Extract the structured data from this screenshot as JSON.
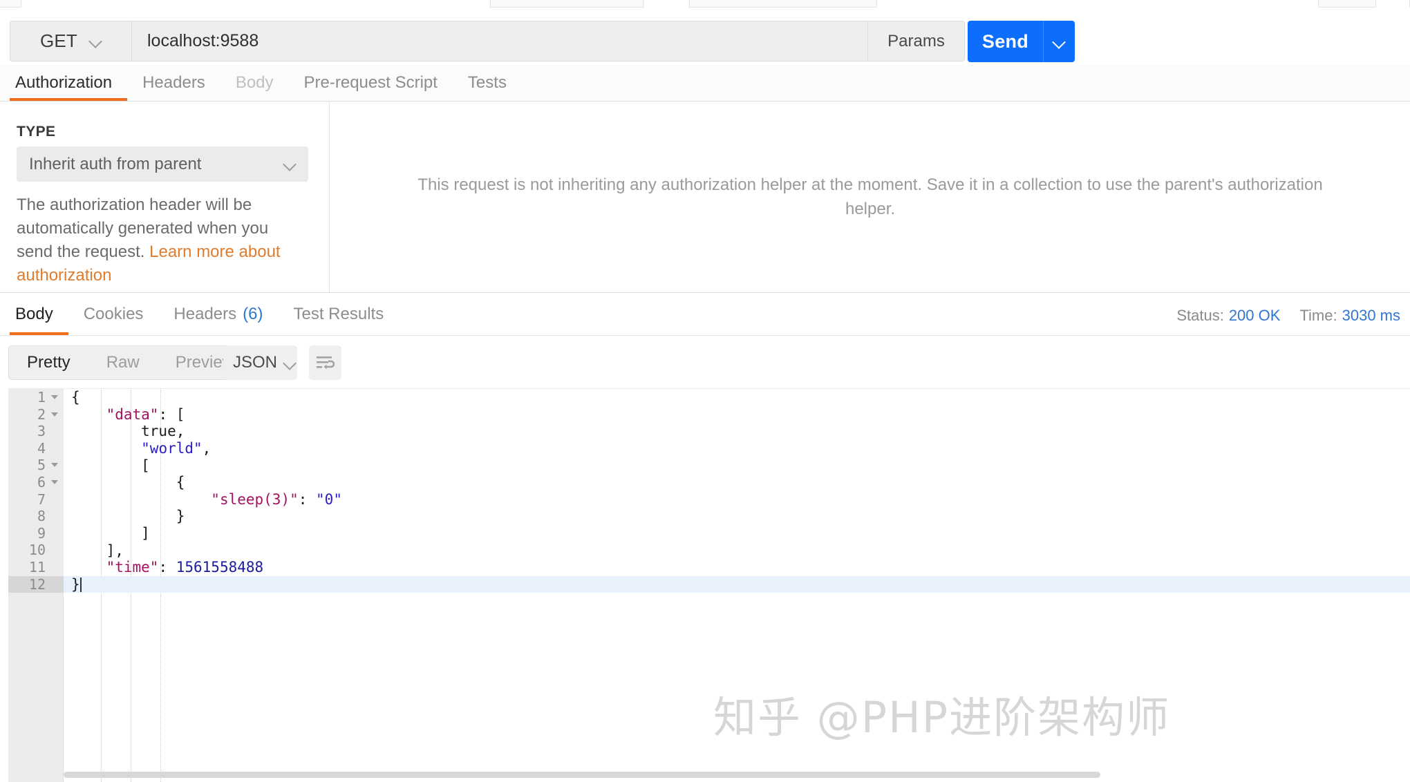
{
  "request": {
    "method": "GET",
    "url": "localhost:9588",
    "params_label": "Params",
    "send_label": "Send",
    "tabs": [
      {
        "label": "Authorization",
        "state": "active"
      },
      {
        "label": "Headers",
        "state": "normal"
      },
      {
        "label": "Body",
        "state": "dim"
      },
      {
        "label": "Pre-request Script",
        "state": "normal"
      },
      {
        "label": "Tests",
        "state": "normal"
      }
    ]
  },
  "auth": {
    "type_heading": "TYPE",
    "type_value": "Inherit auth from parent",
    "description_text": "The authorization header will be automatically generated when you send the request. ",
    "description_link": "Learn more about authorization",
    "inherit_message_line1": "This request is not inheriting any authorization helper at the moment. Save it in a collection to use the parent's authorization",
    "inherit_message_line2": "helper."
  },
  "response": {
    "tabs": [
      {
        "label": "Body",
        "count": "",
        "state": "active"
      },
      {
        "label": "Cookies",
        "count": "",
        "state": "normal"
      },
      {
        "label": "Headers",
        "count": "(6)",
        "state": "normal"
      },
      {
        "label": "Test Results",
        "count": "",
        "state": "normal"
      }
    ],
    "status_label": "Status:",
    "status_value": "200 OK",
    "time_label": "Time:",
    "time_value": "3030 ms",
    "view_modes": [
      {
        "label": "Pretty",
        "state": "active"
      },
      {
        "label": "Raw",
        "state": "normal"
      },
      {
        "label": "Preview",
        "state": "normal"
      }
    ],
    "format": "JSON",
    "wrap_icon": "word-wrap-icon",
    "body_lines": [
      {
        "num": "1",
        "fold": true,
        "segments": [
          {
            "t": "{",
            "c": ""
          }
        ]
      },
      {
        "num": "2",
        "fold": true,
        "segments": [
          {
            "t": "    ",
            "c": ""
          },
          {
            "t": "\"data\"",
            "c": "k"
          },
          {
            "t": ": [",
            "c": ""
          }
        ]
      },
      {
        "num": "3",
        "fold": false,
        "segments": [
          {
            "t": "        true,",
            "c": ""
          }
        ]
      },
      {
        "num": "4",
        "fold": false,
        "segments": [
          {
            "t": "        ",
            "c": ""
          },
          {
            "t": "\"world\"",
            "c": "s"
          },
          {
            "t": ",",
            "c": ""
          }
        ]
      },
      {
        "num": "5",
        "fold": true,
        "segments": [
          {
            "t": "        [",
            "c": ""
          }
        ]
      },
      {
        "num": "6",
        "fold": true,
        "segments": [
          {
            "t": "            {",
            "c": ""
          }
        ]
      },
      {
        "num": "7",
        "fold": false,
        "segments": [
          {
            "t": "                ",
            "c": ""
          },
          {
            "t": "\"sleep(3)\"",
            "c": "k"
          },
          {
            "t": ": ",
            "c": ""
          },
          {
            "t": "\"0\"",
            "c": "s"
          }
        ]
      },
      {
        "num": "8",
        "fold": false,
        "segments": [
          {
            "t": "            }",
            "c": ""
          }
        ]
      },
      {
        "num": "9",
        "fold": false,
        "segments": [
          {
            "t": "        ]",
            "c": ""
          }
        ]
      },
      {
        "num": "10",
        "fold": false,
        "segments": [
          {
            "t": "    ],",
            "c": ""
          }
        ]
      },
      {
        "num": "11",
        "fold": false,
        "segments": [
          {
            "t": "    ",
            "c": ""
          },
          {
            "t": "\"time\"",
            "c": "k"
          },
          {
            "t": ": ",
            "c": ""
          },
          {
            "t": "1561558488",
            "c": "n"
          }
        ]
      },
      {
        "num": "12",
        "fold": false,
        "cursor": true,
        "segments": [
          {
            "t": "}",
            "c": ""
          }
        ]
      }
    ]
  },
  "watermark": {
    "text": "知乎 @PHP进阶架构师"
  },
  "colors": {
    "accent_orange": "#ef6c1a",
    "send_blue": "#0d6efd",
    "link_blue": "#2f76d2",
    "link_orange": "#e07c2d",
    "json_key": "#a3115f",
    "json_string": "#2b1ec4"
  }
}
